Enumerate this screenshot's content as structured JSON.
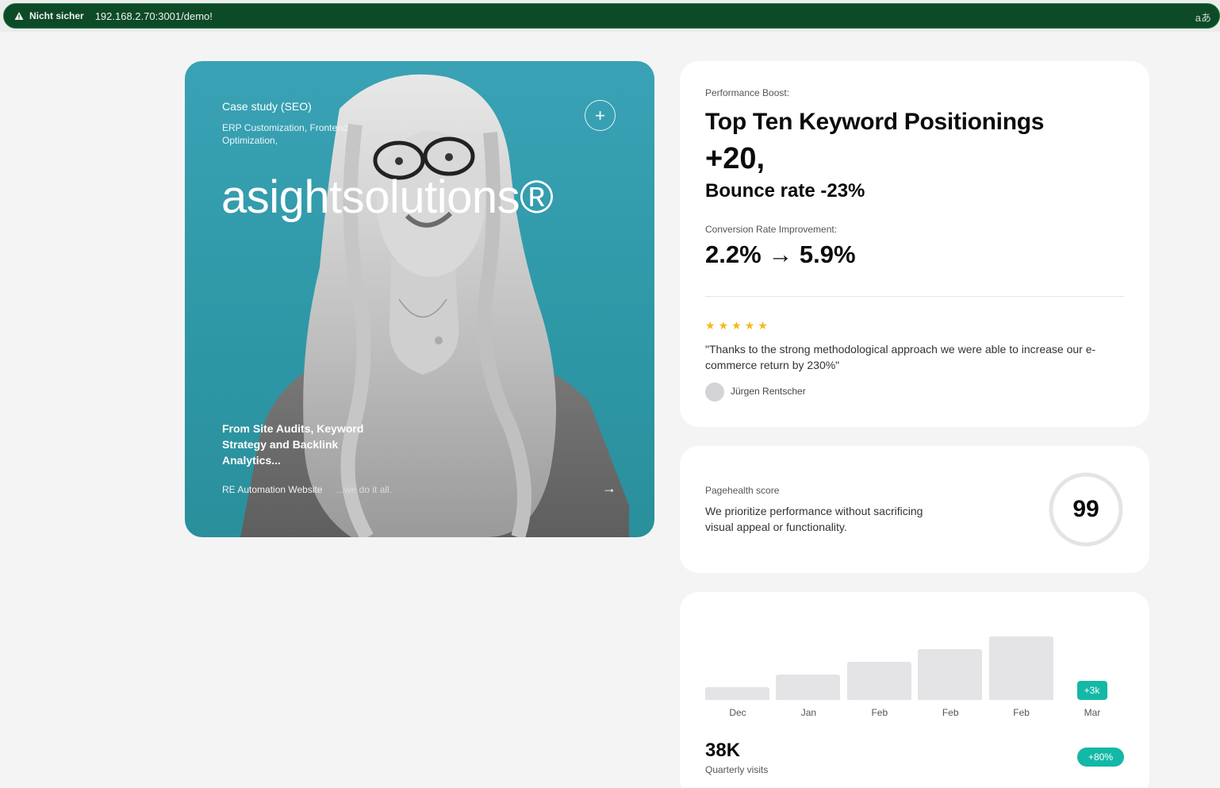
{
  "browser": {
    "security_label": "Nicht sicher",
    "url": "192.168.2.70:3001/demo!",
    "translate_glyph": "aあ"
  },
  "hero": {
    "kicker": "Case study (SEO)",
    "tags": "ERP Customization, Frontend Optimization,",
    "brand": "asightsolutions®",
    "plus_glyph": "+",
    "claim": "From Site Audits, Keyword Strategy and Backlink Analytics...",
    "footer_left": "RE Automation Website",
    "footer_mid": "...we do it all.",
    "arrow_glyph": "→",
    "bg_color": "#3aa2b5"
  },
  "performance": {
    "label": "Performance Boost:",
    "title": "Top Ten Keyword Positionings",
    "plus_value": "+20,",
    "bounce": "Bounce rate -23%",
    "conversion_label": "Conversion Rate Improvement:",
    "conversion_value": "2.2% → 5.9%",
    "rating": 5,
    "star_color": "#f5b91a",
    "quote": "\"Thanks to the strong methodological approach we were able to increase our e-commerce return by 230%\"",
    "author": "Jürgen Rentscher"
  },
  "pagehealth": {
    "label": "Pagehealth score",
    "description": "We prioritize performance without sacrificing visual appeal or functionality.",
    "score": "99"
  },
  "chart_data": {
    "type": "bar",
    "categories": [
      "Dec",
      "Jan",
      "Feb",
      "Feb",
      "Feb",
      "Mar"
    ],
    "values": [
      1,
      2,
      3,
      4,
      5,
      null
    ],
    "highlight_label": "+3k",
    "accent_color": "#14b8a6"
  },
  "visits": {
    "value": "38K",
    "label": "Quarterly visits",
    "change": "+80%"
  }
}
